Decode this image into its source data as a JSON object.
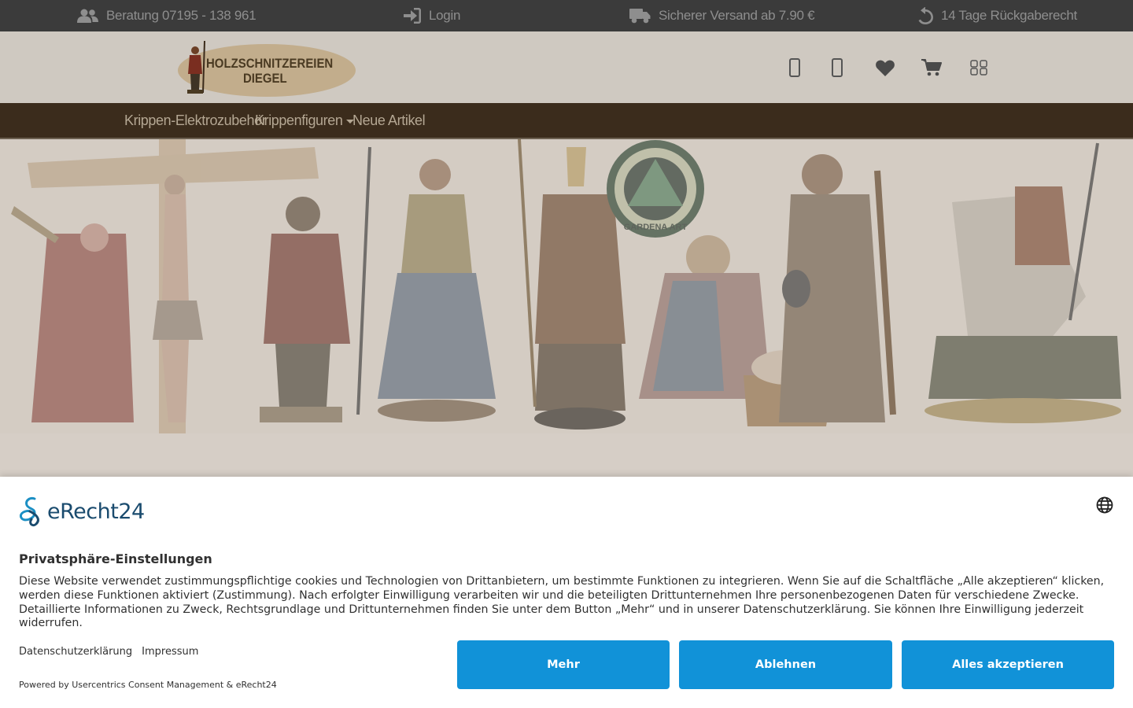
{
  "topbar": {
    "beratung": "Beratung 07195 - 138 961",
    "login": "Login",
    "versand": "Sicherer Versand ab 7.90 €",
    "rueckgabe": "14 Tage Rückgaberecht"
  },
  "header": {
    "logo_line1": "HOLZSCHNITZEREIEN",
    "logo_line2": "DIEGEL",
    "icons": [
      "mobile-icon",
      "mobile-icon",
      "heart-icon",
      "cart-icon",
      "grid-icon"
    ]
  },
  "nav": {
    "items": [
      {
        "label": "Krippen-Elektrozubehör"
      },
      {
        "label": "Krippenfiguren",
        "has_dropdown": true
      },
      {
        "label": "Neue Artikel"
      }
    ]
  },
  "banner": {
    "badge_text": "GARDENA ART"
  },
  "consent": {
    "brand": "eRecht24",
    "title": "Privatsphäre-Einstellungen",
    "body": "Diese Website verwendet zustimmungspflichtige cookies und Technologien von Drittanbietern, um bestimmte Funktionen zu integrieren. Wenn Sie auf die Schaltfläche „Alle akzeptieren“ klicken, werden diese Funktionen aktiviert (Zustimmung). Nach erfolgter Einwilligung verarbeiten wir und die beteiligten Drittunternehmen Ihre personenbezogenen Daten für verschiedene Zwecke. Detaillierte Informationen zu Zweck, Rechtsgrundlage und Drittunternehmen finden Sie unter dem Button „Mehr“ und in unserer Datenschutzerklärung. Sie können Ihre Einwilligung jederzeit widerrufen.",
    "link_privacy": "Datenschutzerklärung",
    "link_imprint": "Impressum",
    "powered_by": "Powered by Usercentrics Consent Management & eRecht24",
    "btn_more": "Mehr",
    "btn_decline": "Ablehnen",
    "btn_accept": "Alles akzeptieren",
    "button_color": "#1192d8"
  },
  "colors": {
    "topbar_bg": "#3b3b3b",
    "nav_bg": "#3b2c1c",
    "overlay": "#d9d2c9"
  }
}
